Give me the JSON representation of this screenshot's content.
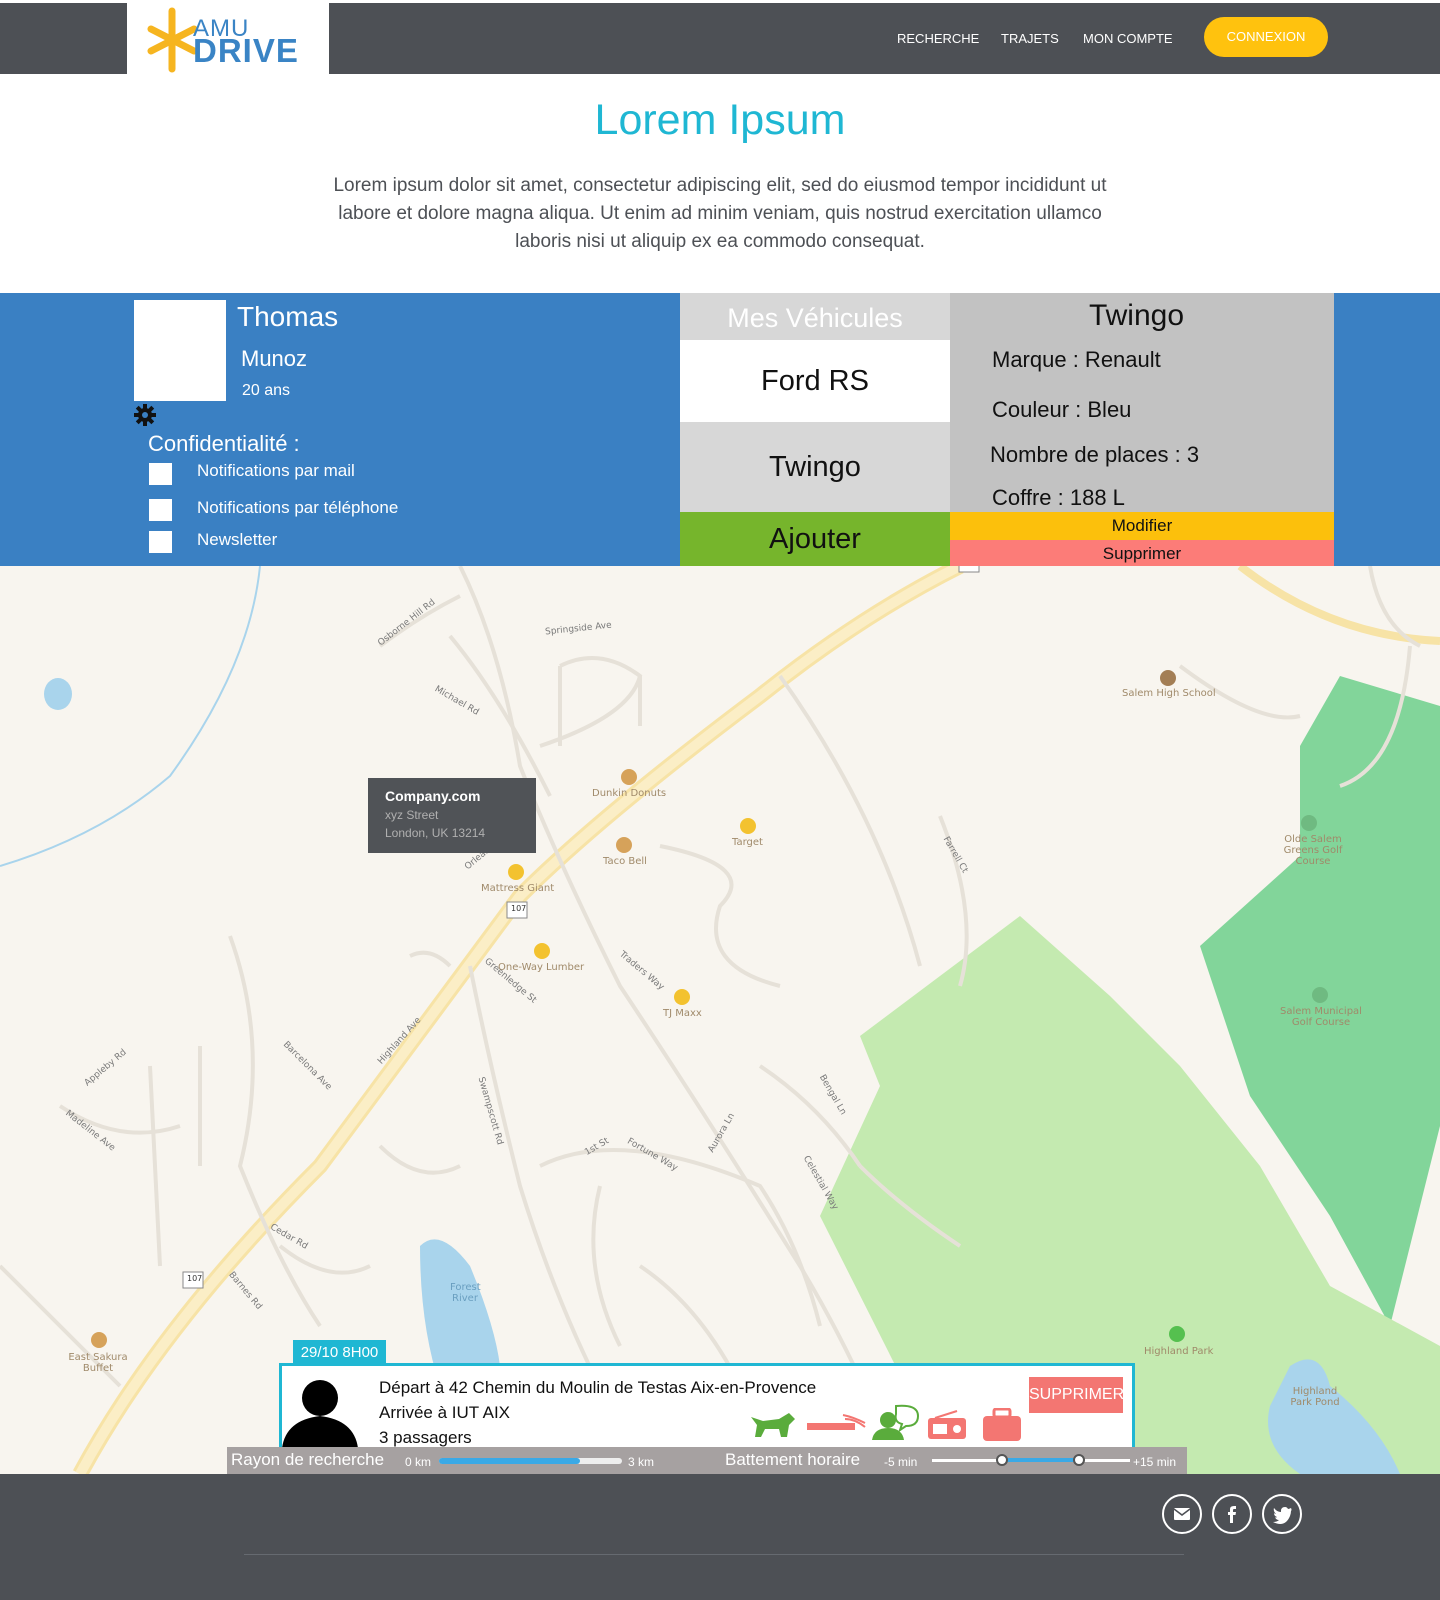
{
  "brand": {
    "name_top": "AMU",
    "name_bottom": "DRIVE",
    "star_color": "#f6b520",
    "text_color": "#3a84c5"
  },
  "nav": {
    "items": [
      {
        "label": "RECHERCHE"
      },
      {
        "label": "TRAJETS"
      },
      {
        "label": "MON COMPTE"
      }
    ],
    "login_label": "CONNEXION",
    "login_color": "#ffc20e"
  },
  "hero": {
    "title": "Lorem Ipsum",
    "text": "Lorem ipsum dolor sit amet, consectetur adipiscing elit, sed do eiusmod tempor incididunt ut labore et dolore magna aliqua. Ut enim ad minim veniam, quis nostrud exercitation ullamco laboris nisi ut aliquip ex ea commodo consequat."
  },
  "profile": {
    "first_name": "Thomas",
    "last_name": "Munoz",
    "age": "20 ans",
    "privacy_title": "Confidentialité :",
    "privacy_options": [
      {
        "label": "Notifications par mail",
        "checked": false
      },
      {
        "label": "Notifications par téléphone",
        "checked": false
      },
      {
        "label": "Newsletter",
        "checked": false
      }
    ]
  },
  "vehicles": {
    "header": "Mes Véhicules",
    "items": [
      {
        "label": "Ford RS"
      },
      {
        "label": "Twingo"
      }
    ],
    "add_label": "Ajouter"
  },
  "vehicle_detail": {
    "title": "Twingo",
    "brand": "Marque : Renault",
    "color": "Couleur : Bleu",
    "seats": "Nombre de places : 3",
    "trunk": "Coffre : 188 L",
    "modify_label": "Modifier",
    "delete_label": "Supprimer"
  },
  "map": {
    "tooltip": {
      "title": "Company.com",
      "street": "xyz Street",
      "city": "London, UK 13214"
    },
    "pois": [
      "Salem High School",
      "Dunkin Donuts",
      "Taco Bell",
      "Target",
      "Mattress Giant",
      "One-Way Lumber",
      "TJ Maxx",
      "Olde Salem Greens Golf Course",
      "Salem Municipal Golf Course",
      "Highland Park",
      "Highland Park Pond",
      "East Sakura Buffet",
      "Forest River"
    ],
    "streets": [
      "Highland Ave",
      "Swampscott Rd",
      "Springside Ave",
      "Osborne Hill Rd",
      "Michael Rd",
      "Greenledge St",
      "Traders Way",
      "Barcelona Ave",
      "Appleby Rd",
      "Madeline Ave",
      "Cedar Rd",
      "Barnes Rd",
      "Fortune Way",
      "Aurora Ln",
      "Bengal Ln",
      "Celestial Way",
      "1st St",
      "Orleans Ave",
      "Farrell Ct"
    ],
    "route_shield": "107"
  },
  "trip": {
    "date": "29/10  8H00",
    "departure": "Départ à 42 Chemin du Moulin de Testas Aix-en-Provence",
    "arrival": "Arrivée à IUT AIX",
    "passengers": "3 passagers",
    "delete_label": "SUPPRIMER",
    "amenity_icons": [
      "pets-icon",
      "smoking-icon",
      "chat-icon",
      "radio-icon",
      "luggage-icon"
    ]
  },
  "filters": {
    "radius_label": "Rayon de recherche",
    "radius_min": "0 km",
    "radius_max": "3 km",
    "radius_value_fraction": 0.77,
    "time_label": "Battement horaire",
    "time_min": "-5 min",
    "time_max": "+15 min"
  },
  "footer": {
    "social_icons": [
      "mail-icon",
      "facebook-icon",
      "twitter-icon"
    ]
  }
}
